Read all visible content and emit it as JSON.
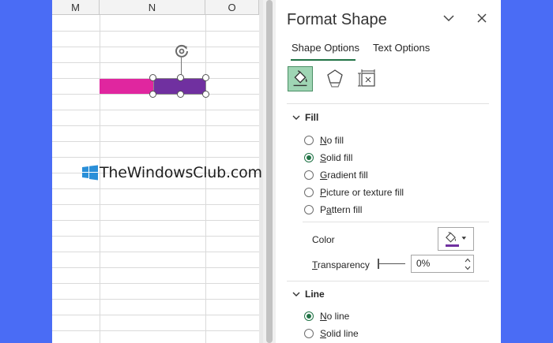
{
  "sheet": {
    "columns": [
      "M",
      "N",
      "O"
    ]
  },
  "pane": {
    "title": "Format Shape",
    "tabs": [
      {
        "label": "Shape Options",
        "active": true
      },
      {
        "label": "Text Options",
        "active": false
      }
    ],
    "category_icons": [
      "fill-line-icon",
      "effects-icon",
      "size-properties-icon"
    ],
    "fill": {
      "heading": "Fill",
      "options": [
        {
          "label": "No fill",
          "selected": false,
          "accel": "N"
        },
        {
          "label": "Solid fill",
          "selected": true,
          "accel": "S"
        },
        {
          "label": "Gradient fill",
          "selected": false,
          "accel": "G"
        },
        {
          "label": "Picture or texture fill",
          "selected": false,
          "accel": "P"
        },
        {
          "label": "Pattern fill",
          "selected": false,
          "accel": "A"
        }
      ],
      "color_label": "Color",
      "color_value": "#7030a0",
      "transparency_label": "Transparency",
      "transparency_value": "0%"
    },
    "line": {
      "heading": "Line",
      "options": [
        {
          "label": "No line",
          "selected": true
        },
        {
          "label": "Solid line",
          "selected": false
        }
      ]
    }
  },
  "colors": {
    "accent": "#217346",
    "bar_pink": "#e0269f",
    "bar_purple": "#7030a0",
    "background": "#4a6cf5"
  },
  "watermark": {
    "text": "TheWindowsClub.com"
  }
}
